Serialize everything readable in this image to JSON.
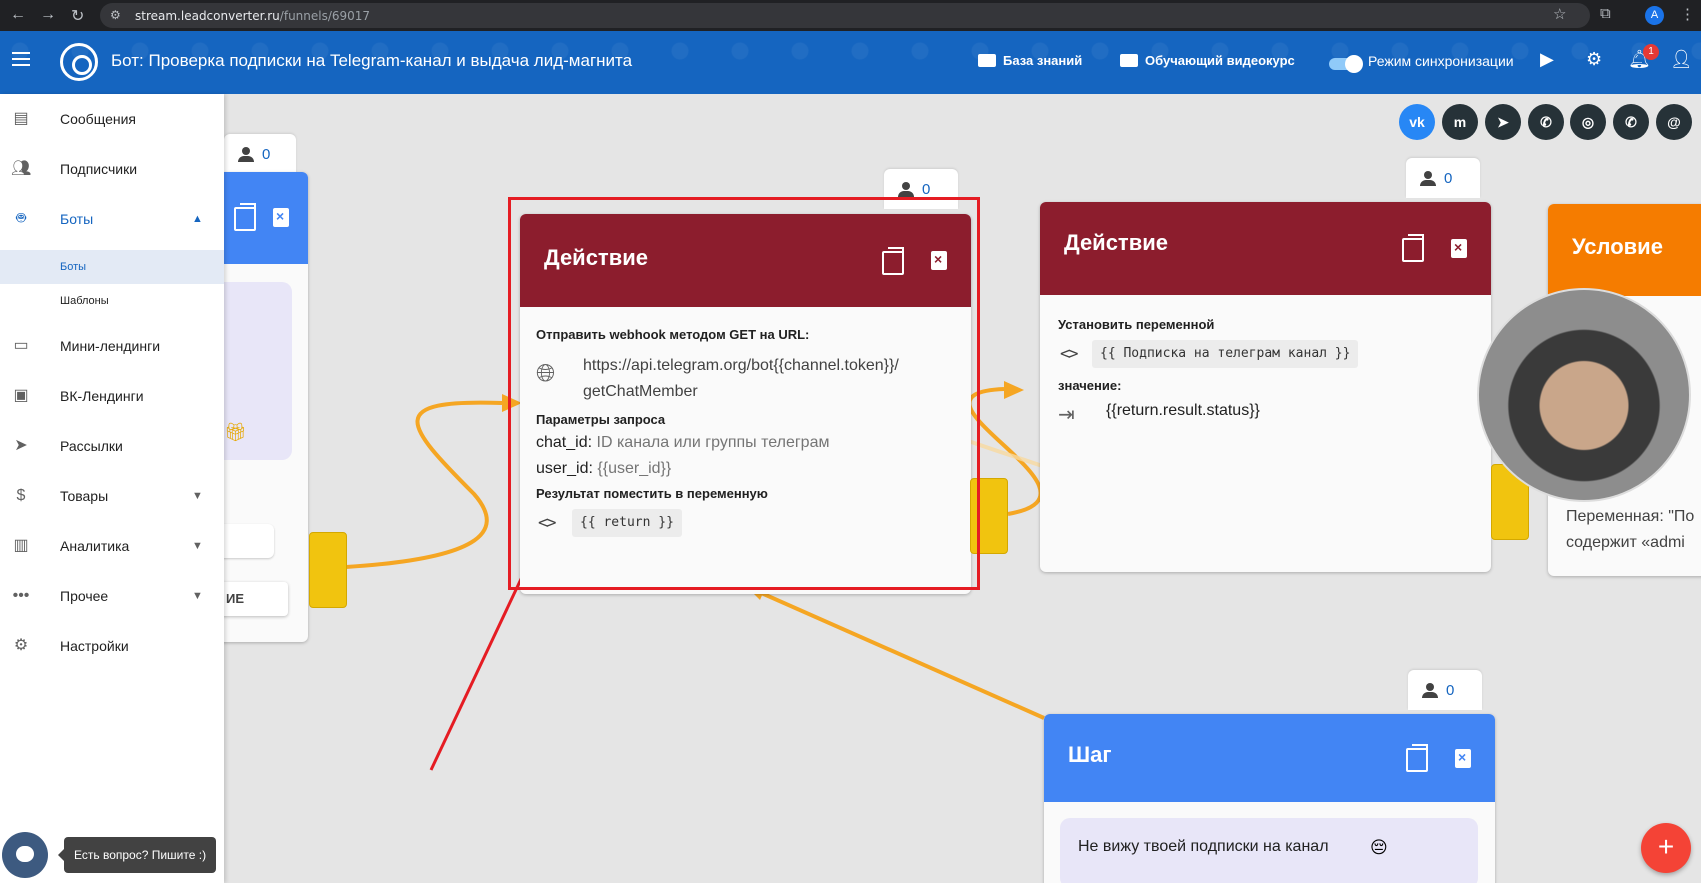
{
  "browser": {
    "url_host": "stream.leadconverter.ru",
    "url_path": "/funnels/69017",
    "profile_initial": "A"
  },
  "header": {
    "title": "Бот: Проверка подписки на Telegram-канал и выдача лид-магнита",
    "knowledge_base": "База знаний",
    "video_course": "Обучающий видеокурс",
    "sync_mode": "Режим синхронизации",
    "notifications_count": "1"
  },
  "sidebar": {
    "items": [
      {
        "label": "Сообщения",
        "icon": "chat-icon"
      },
      {
        "label": "Подписчики",
        "icon": "people-icon"
      },
      {
        "label": "Боты",
        "icon": "robot-icon"
      },
      {
        "label": "Мини-лендинги",
        "icon": "window-icon"
      },
      {
        "label": "ВК-Лендинги",
        "icon": "card-icon"
      },
      {
        "label": "Рассылки",
        "icon": "send-icon"
      },
      {
        "label": "Товары",
        "icon": "dollar-icon"
      },
      {
        "label": "Аналитика",
        "icon": "analytics-icon"
      },
      {
        "label": "Прочее",
        "icon": "more-icon"
      },
      {
        "label": "Настройки",
        "icon": "gear-icon"
      }
    ],
    "sub_items": [
      "Боты",
      "Шаблоны"
    ],
    "help_tooltip": "Есть вопрос? Пишите :)"
  },
  "canvas": {
    "left_card": {
      "counter": "0",
      "button_fragment": "ИЕ"
    },
    "action_card_1": {
      "counter": "0",
      "title": "Действие",
      "webhook_label": "Отправить webhook методом GET на URL:",
      "url_line1": "https://api.telegram.org/bot{{channel.token}}/",
      "url_line2": "getChatMember",
      "params_label": "Параметры запроса",
      "param1_key": "chat_id:",
      "param1_value": "ID канала или группы телеграм",
      "param2_key": "user_id:",
      "param2_value": "{{user_id}}",
      "result_label": "Результат поместить в переменную",
      "result_var": "{{ return }}"
    },
    "action_card_2": {
      "counter": "0",
      "title": "Действие",
      "set_var_label": "Установить переменной",
      "var_name": "{{ Подписка на телеграм канал }}",
      "value_label": "значение:",
      "value": "{{return.result.status}}"
    },
    "condition_card": {
      "title": "Условие",
      "frag1": "Переменная: \"По",
      "frag2": "содержит «admi"
    },
    "step_card": {
      "counter": "0",
      "title": "Шаг",
      "message": "Не вижу твоей подписки на канал"
    },
    "socials": [
      "VK",
      "Messenger",
      "Telegram",
      "Viber",
      "Instagram",
      "WhatsApp",
      "Email"
    ],
    "social_glyphs": [
      "vk",
      "m",
      "➤",
      "✆",
      "◎",
      "✆",
      "@"
    ],
    "fab_label": "+"
  },
  "colors": {
    "header_blue": "#1565c0",
    "action_wine": "#8c1d2d",
    "condition_orange": "#f57c00",
    "step_blue": "#4285f4",
    "connector_yellow": "#f1c40f",
    "highlight_red": "#e51c23"
  }
}
